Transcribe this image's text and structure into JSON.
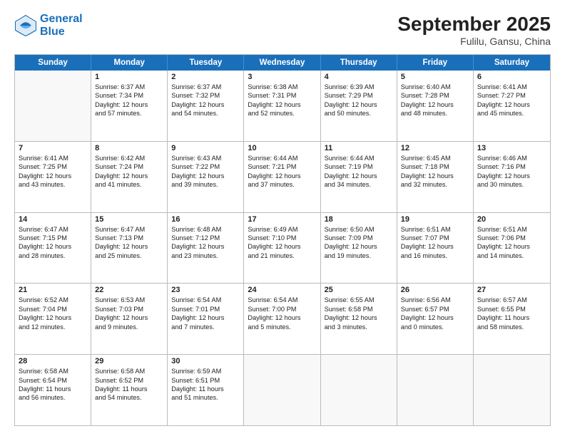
{
  "header": {
    "logo_general": "General",
    "logo_blue": "Blue",
    "month_title": "September 2025",
    "subtitle": "Fulilu, Gansu, China"
  },
  "weekdays": [
    "Sunday",
    "Monday",
    "Tuesday",
    "Wednesday",
    "Thursday",
    "Friday",
    "Saturday"
  ],
  "rows": [
    [
      {
        "day": "",
        "sunrise": "",
        "sunset": "",
        "daylight": ""
      },
      {
        "day": "1",
        "sunrise": "Sunrise: 6:37 AM",
        "sunset": "Sunset: 7:34 PM",
        "daylight": "Daylight: 12 hours and 57 minutes."
      },
      {
        "day": "2",
        "sunrise": "Sunrise: 6:37 AM",
        "sunset": "Sunset: 7:32 PM",
        "daylight": "Daylight: 12 hours and 54 minutes."
      },
      {
        "day": "3",
        "sunrise": "Sunrise: 6:38 AM",
        "sunset": "Sunset: 7:31 PM",
        "daylight": "Daylight: 12 hours and 52 minutes."
      },
      {
        "day": "4",
        "sunrise": "Sunrise: 6:39 AM",
        "sunset": "Sunset: 7:29 PM",
        "daylight": "Daylight: 12 hours and 50 minutes."
      },
      {
        "day": "5",
        "sunrise": "Sunrise: 6:40 AM",
        "sunset": "Sunset: 7:28 PM",
        "daylight": "Daylight: 12 hours and 48 minutes."
      },
      {
        "day": "6",
        "sunrise": "Sunrise: 6:41 AM",
        "sunset": "Sunset: 7:27 PM",
        "daylight": "Daylight: 12 hours and 45 minutes."
      }
    ],
    [
      {
        "day": "7",
        "sunrise": "Sunrise: 6:41 AM",
        "sunset": "Sunset: 7:25 PM",
        "daylight": "Daylight: 12 hours and 43 minutes."
      },
      {
        "day": "8",
        "sunrise": "Sunrise: 6:42 AM",
        "sunset": "Sunset: 7:24 PM",
        "daylight": "Daylight: 12 hours and 41 minutes."
      },
      {
        "day": "9",
        "sunrise": "Sunrise: 6:43 AM",
        "sunset": "Sunset: 7:22 PM",
        "daylight": "Daylight: 12 hours and 39 minutes."
      },
      {
        "day": "10",
        "sunrise": "Sunrise: 6:44 AM",
        "sunset": "Sunset: 7:21 PM",
        "daylight": "Daylight: 12 hours and 37 minutes."
      },
      {
        "day": "11",
        "sunrise": "Sunrise: 6:44 AM",
        "sunset": "Sunset: 7:19 PM",
        "daylight": "Daylight: 12 hours and 34 minutes."
      },
      {
        "day": "12",
        "sunrise": "Sunrise: 6:45 AM",
        "sunset": "Sunset: 7:18 PM",
        "daylight": "Daylight: 12 hours and 32 minutes."
      },
      {
        "day": "13",
        "sunrise": "Sunrise: 6:46 AM",
        "sunset": "Sunset: 7:16 PM",
        "daylight": "Daylight: 12 hours and 30 minutes."
      }
    ],
    [
      {
        "day": "14",
        "sunrise": "Sunrise: 6:47 AM",
        "sunset": "Sunset: 7:15 PM",
        "daylight": "Daylight: 12 hours and 28 minutes."
      },
      {
        "day": "15",
        "sunrise": "Sunrise: 6:47 AM",
        "sunset": "Sunset: 7:13 PM",
        "daylight": "Daylight: 12 hours and 25 minutes."
      },
      {
        "day": "16",
        "sunrise": "Sunrise: 6:48 AM",
        "sunset": "Sunset: 7:12 PM",
        "daylight": "Daylight: 12 hours and 23 minutes."
      },
      {
        "day": "17",
        "sunrise": "Sunrise: 6:49 AM",
        "sunset": "Sunset: 7:10 PM",
        "daylight": "Daylight: 12 hours and 21 minutes."
      },
      {
        "day": "18",
        "sunrise": "Sunrise: 6:50 AM",
        "sunset": "Sunset: 7:09 PM",
        "daylight": "Daylight: 12 hours and 19 minutes."
      },
      {
        "day": "19",
        "sunrise": "Sunrise: 6:51 AM",
        "sunset": "Sunset: 7:07 PM",
        "daylight": "Daylight: 12 hours and 16 minutes."
      },
      {
        "day": "20",
        "sunrise": "Sunrise: 6:51 AM",
        "sunset": "Sunset: 7:06 PM",
        "daylight": "Daylight: 12 hours and 14 minutes."
      }
    ],
    [
      {
        "day": "21",
        "sunrise": "Sunrise: 6:52 AM",
        "sunset": "Sunset: 7:04 PM",
        "daylight": "Daylight: 12 hours and 12 minutes."
      },
      {
        "day": "22",
        "sunrise": "Sunrise: 6:53 AM",
        "sunset": "Sunset: 7:03 PM",
        "daylight": "Daylight: 12 hours and 9 minutes."
      },
      {
        "day": "23",
        "sunrise": "Sunrise: 6:54 AM",
        "sunset": "Sunset: 7:01 PM",
        "daylight": "Daylight: 12 hours and 7 minutes."
      },
      {
        "day": "24",
        "sunrise": "Sunrise: 6:54 AM",
        "sunset": "Sunset: 7:00 PM",
        "daylight": "Daylight: 12 hours and 5 minutes."
      },
      {
        "day": "25",
        "sunrise": "Sunrise: 6:55 AM",
        "sunset": "Sunset: 6:58 PM",
        "daylight": "Daylight: 12 hours and 3 minutes."
      },
      {
        "day": "26",
        "sunrise": "Sunrise: 6:56 AM",
        "sunset": "Sunset: 6:57 PM",
        "daylight": "Daylight: 12 hours and 0 minutes."
      },
      {
        "day": "27",
        "sunrise": "Sunrise: 6:57 AM",
        "sunset": "Sunset: 6:55 PM",
        "daylight": "Daylight: 11 hours and 58 minutes."
      }
    ],
    [
      {
        "day": "28",
        "sunrise": "Sunrise: 6:58 AM",
        "sunset": "Sunset: 6:54 PM",
        "daylight": "Daylight: 11 hours and 56 minutes."
      },
      {
        "day": "29",
        "sunrise": "Sunrise: 6:58 AM",
        "sunset": "Sunset: 6:52 PM",
        "daylight": "Daylight: 11 hours and 54 minutes."
      },
      {
        "day": "30",
        "sunrise": "Sunrise: 6:59 AM",
        "sunset": "Sunset: 6:51 PM",
        "daylight": "Daylight: 11 hours and 51 minutes."
      },
      {
        "day": "",
        "sunrise": "",
        "sunset": "",
        "daylight": ""
      },
      {
        "day": "",
        "sunrise": "",
        "sunset": "",
        "daylight": ""
      },
      {
        "day": "",
        "sunrise": "",
        "sunset": "",
        "daylight": ""
      },
      {
        "day": "",
        "sunrise": "",
        "sunset": "",
        "daylight": ""
      }
    ]
  ]
}
